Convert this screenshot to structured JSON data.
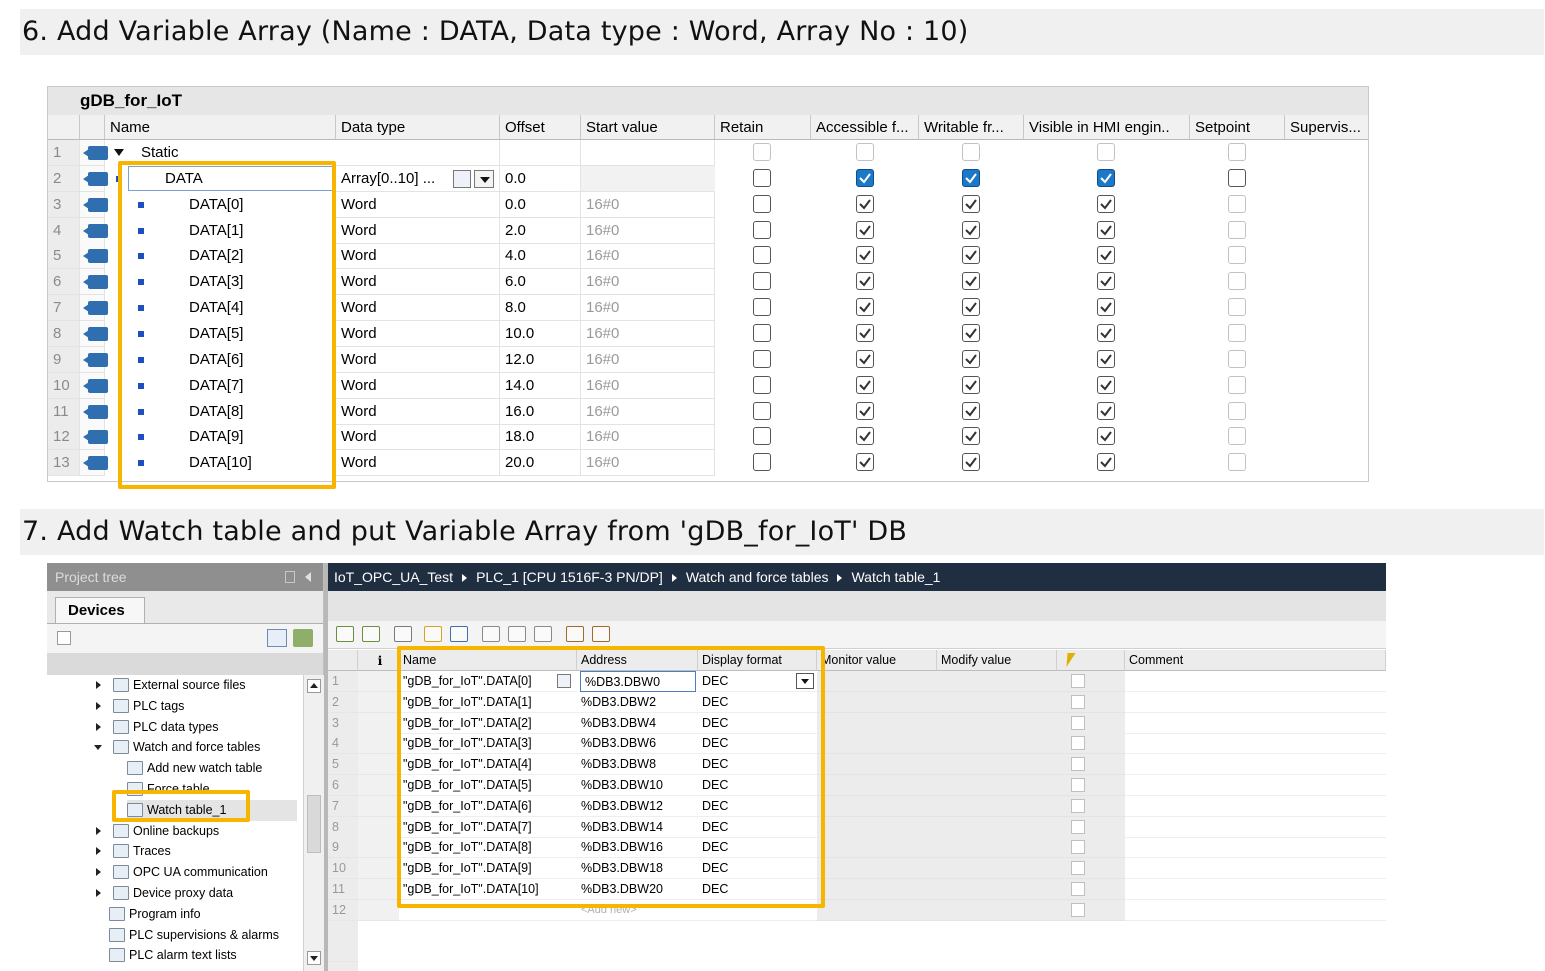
{
  "step6": {
    "title": "6. Add Variable Array (Name : DATA, Data type : Word, Array No : 10)"
  },
  "step7": {
    "title": "7. Add Watch table and put Variable Array from 'gDB_for_IoT' DB"
  },
  "db": {
    "title": "gDB_for_IoT",
    "columns": [
      "Name",
      "Data type",
      "Offset",
      "Start value",
      "Retain",
      "Accessible f...",
      "Writable fr...",
      "Visible in HMI engin..",
      "Setpoint",
      "Supervis..."
    ],
    "rows": [
      {
        "num": "1",
        "name": "Static",
        "type": "",
        "offset": "",
        "start": ""
      },
      {
        "num": "2",
        "name": "DATA",
        "type": "Array[0..10] ...",
        "offset": "0.0",
        "start": ""
      },
      {
        "num": "3",
        "name": "DATA[0]",
        "type": "Word",
        "offset": "0.0",
        "start": "16#0"
      },
      {
        "num": "4",
        "name": "DATA[1]",
        "type": "Word",
        "offset": "2.0",
        "start": "16#0"
      },
      {
        "num": "5",
        "name": "DATA[2]",
        "type": "Word",
        "offset": "4.0",
        "start": "16#0"
      },
      {
        "num": "6",
        "name": "DATA[3]",
        "type": "Word",
        "offset": "6.0",
        "start": "16#0"
      },
      {
        "num": "7",
        "name": "DATA[4]",
        "type": "Word",
        "offset": "8.0",
        "start": "16#0"
      },
      {
        "num": "8",
        "name": "DATA[5]",
        "type": "Word",
        "offset": "10.0",
        "start": "16#0"
      },
      {
        "num": "9",
        "name": "DATA[6]",
        "type": "Word",
        "offset": "12.0",
        "start": "16#0"
      },
      {
        "num": "10",
        "name": "DATA[7]",
        "type": "Word",
        "offset": "14.0",
        "start": "16#0"
      },
      {
        "num": "11",
        "name": "DATA[8]",
        "type": "Word",
        "offset": "16.0",
        "start": "16#0"
      },
      {
        "num": "12",
        "name": "DATA[9]",
        "type": "Word",
        "offset": "18.0",
        "start": "16#0"
      },
      {
        "num": "13",
        "name": "DATA[10]",
        "type": "Word",
        "offset": "20.0",
        "start": "16#0"
      }
    ]
  },
  "tree": {
    "title": "Project tree",
    "tab": "Devices",
    "items": [
      {
        "label": "External source files",
        "kind": "collapsed"
      },
      {
        "label": "PLC tags",
        "kind": "collapsed"
      },
      {
        "label": "PLC data types",
        "kind": "collapsed"
      },
      {
        "label": "Watch and force tables",
        "kind": "expanded"
      },
      {
        "label": "Add new watch table",
        "kind": "child"
      },
      {
        "label": "Force table",
        "kind": "child"
      },
      {
        "label": "Watch table_1",
        "kind": "child"
      },
      {
        "label": "Online backups",
        "kind": "collapsed"
      },
      {
        "label": "Traces",
        "kind": "collapsed"
      },
      {
        "label": "OPC UA communication",
        "kind": "collapsed"
      },
      {
        "label": "Device proxy data",
        "kind": "collapsed"
      },
      {
        "label": "Program info",
        "kind": "leaf"
      },
      {
        "label": "PLC supervisions & alarms",
        "kind": "leaf"
      },
      {
        "label": "PLC alarm text lists",
        "kind": "leaf"
      }
    ]
  },
  "breadcrumb": [
    "IoT_OPC_UA_Test",
    "PLC_1 [CPU 1516F-3 PN/DP]",
    "Watch and force tables",
    "Watch table_1"
  ],
  "watch": {
    "columns": [
      "i",
      "Name",
      "Address",
      "Display format",
      "Monitor value",
      "Modify value",
      "Comment"
    ],
    "rows": [
      {
        "num": "1",
        "name": "\"gDB_for_IoT\".DATA[0]",
        "address": "%DB3.DBW0",
        "format": "DEC"
      },
      {
        "num": "2",
        "name": "\"gDB_for_IoT\".DATA[1]",
        "address": "%DB3.DBW2",
        "format": "DEC"
      },
      {
        "num": "3",
        "name": "\"gDB_for_IoT\".DATA[2]",
        "address": "%DB3.DBW4",
        "format": "DEC"
      },
      {
        "num": "4",
        "name": "\"gDB_for_IoT\".DATA[3]",
        "address": "%DB3.DBW6",
        "format": "DEC"
      },
      {
        "num": "5",
        "name": "\"gDB_for_IoT\".DATA[4]",
        "address": "%DB3.DBW8",
        "format": "DEC"
      },
      {
        "num": "6",
        "name": "\"gDB_for_IoT\".DATA[5]",
        "address": "%DB3.DBW10",
        "format": "DEC"
      },
      {
        "num": "7",
        "name": "\"gDB_for_IoT\".DATA[6]",
        "address": "%DB3.DBW12",
        "format": "DEC"
      },
      {
        "num": "8",
        "name": "\"gDB_for_IoT\".DATA[7]",
        "address": "%DB3.DBW14",
        "format": "DEC"
      },
      {
        "num": "9",
        "name": "\"gDB_for_IoT\".DATA[8]",
        "address": "%DB3.DBW16",
        "format": "DEC"
      },
      {
        "num": "10",
        "name": "\"gDB_for_IoT\".DATA[9]",
        "address": "%DB3.DBW18",
        "format": "DEC"
      },
      {
        "num": "11",
        "name": "\"gDB_for_IoT\".DATA[10]",
        "address": "%DB3.DBW20",
        "format": "DEC"
      },
      {
        "num": "12",
        "name": "",
        "address": "<Add new>",
        "format": ""
      }
    ]
  },
  "colors": {
    "highlight": "#f7b500",
    "checkbox_blue": "#1e78c8",
    "breadcrumb_bg": "#1f2e40"
  },
  "icons": [
    "interface-arrow-icon",
    "expand-triangle-icon",
    "checkbox-icon",
    "folder-icon",
    "watch-table-icon",
    "dropdown-arrow-icon",
    "scroll-arrow-icon"
  ]
}
